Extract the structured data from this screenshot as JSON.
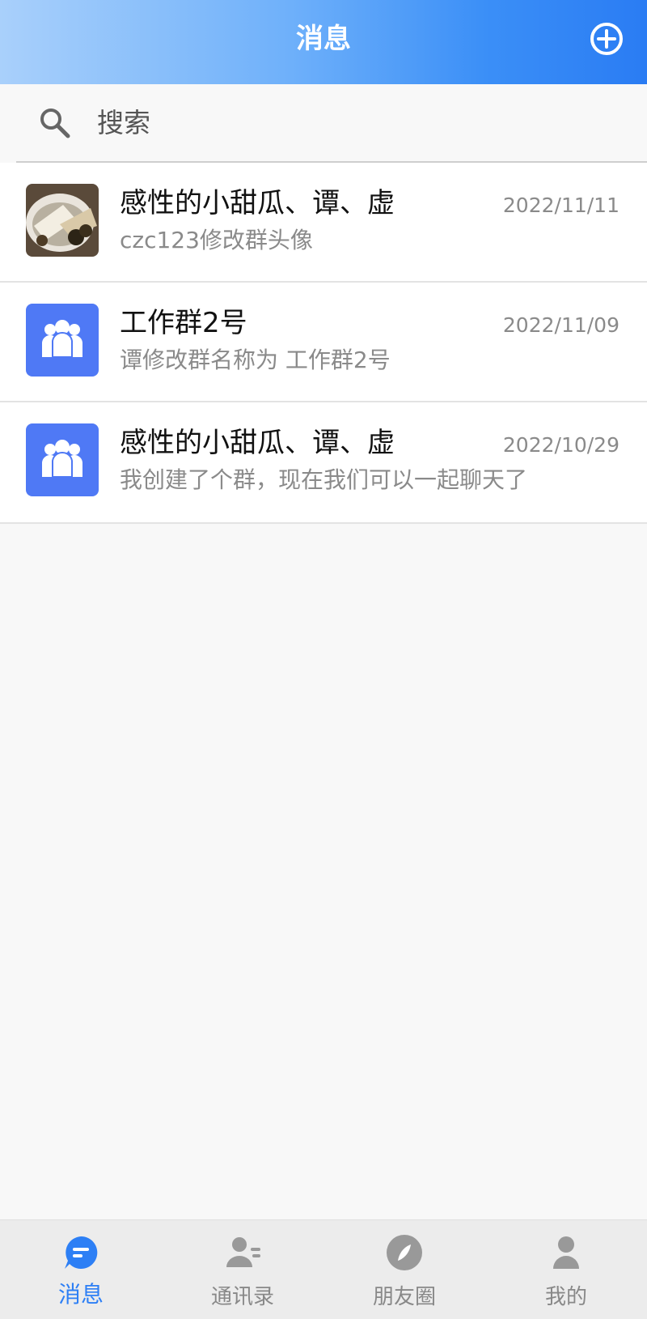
{
  "header": {
    "title": "消息"
  },
  "search": {
    "placeholder": "搜索"
  },
  "conversations": [
    {
      "name": "感性的小甜瓜、谭、虚",
      "last_message": "czc123修改群头像",
      "date": "2022/11/11",
      "avatar": "photo"
    },
    {
      "name": "工作群2号",
      "last_message": "谭修改群名称为  工作群2号",
      "date": "2022/11/09",
      "avatar": "group-icon"
    },
    {
      "name": "感性的小甜瓜、谭、虚",
      "last_message": "我创建了个群，现在我们可以一起聊天了",
      "date": "2022/10/29",
      "avatar": "group-icon"
    }
  ],
  "tabbar": {
    "tabs": [
      {
        "label": "消息",
        "icon": "chat-bubble-icon",
        "active": true
      },
      {
        "label": "通讯录",
        "icon": "contacts-icon",
        "active": false
      },
      {
        "label": "朋友圈",
        "icon": "compass-icon",
        "active": false
      },
      {
        "label": "我的",
        "icon": "profile-icon",
        "active": false
      }
    ]
  },
  "colors": {
    "accent": "#2d7ff5",
    "group_avatar": "#4f79f5",
    "inactive": "#888888"
  }
}
